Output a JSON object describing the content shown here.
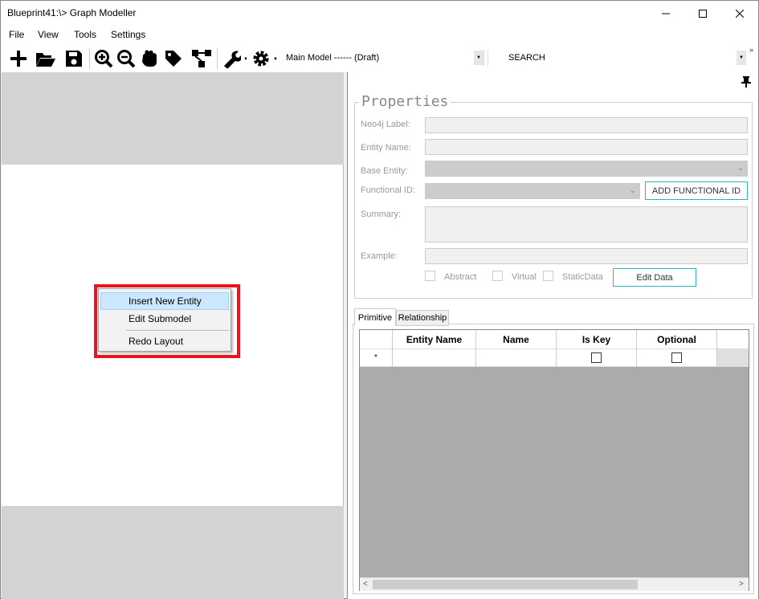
{
  "window": {
    "title": "Blueprint41:\\> Graph Modeller"
  },
  "menu": {
    "items": [
      "File",
      "View",
      "Tools",
      "Settings"
    ]
  },
  "toolbar": {
    "model_select": "Main Model ------ (Draft)",
    "search_placeholder": "SEARCH",
    "icons": [
      "add-icon",
      "open-folder-icon",
      "save-icon",
      "zoom-in-icon",
      "zoom-out-icon",
      "pan-hand-icon",
      "tag-icon",
      "layout-tree-icon",
      "wrench-icon",
      "gear-icon"
    ]
  },
  "context_menu": {
    "items": [
      {
        "label": "Insert New Entity",
        "active": true
      },
      {
        "label": "Edit Submodel",
        "active": false
      },
      {
        "label": "Redo Layout",
        "active": false
      }
    ]
  },
  "properties": {
    "title": "Properties",
    "neo4j_label": {
      "label": "Neo4j Label:",
      "value": ""
    },
    "entity_name": {
      "label": "Entity Name:",
      "value": ""
    },
    "base_entity": {
      "label": "Base Entity:",
      "value": ""
    },
    "functional_id": {
      "label": "Functional ID:",
      "value": ""
    },
    "add_functional_id_button": "ADD FUNCTIONAL ID",
    "summary": {
      "label": "Summary:",
      "value": ""
    },
    "example": {
      "label": "Example:",
      "value": ""
    },
    "checkboxes": [
      {
        "label": "Abstract",
        "checked": false
      },
      {
        "label": "Virtual",
        "checked": false
      },
      {
        "label": "StaticData",
        "checked": false
      }
    ],
    "edit_data_button": "Edit Data"
  },
  "tabs": [
    {
      "label": "Primitive",
      "selected": true
    },
    {
      "label": "Relationship",
      "selected": false
    }
  ],
  "grid": {
    "columns": [
      "Entity Name",
      "Name",
      "Is Key",
      "Optional"
    ],
    "new_row_marker": "*",
    "rows": [
      {
        "entity_name": "",
        "name": "",
        "is_key": false,
        "optional": false
      }
    ]
  }
}
